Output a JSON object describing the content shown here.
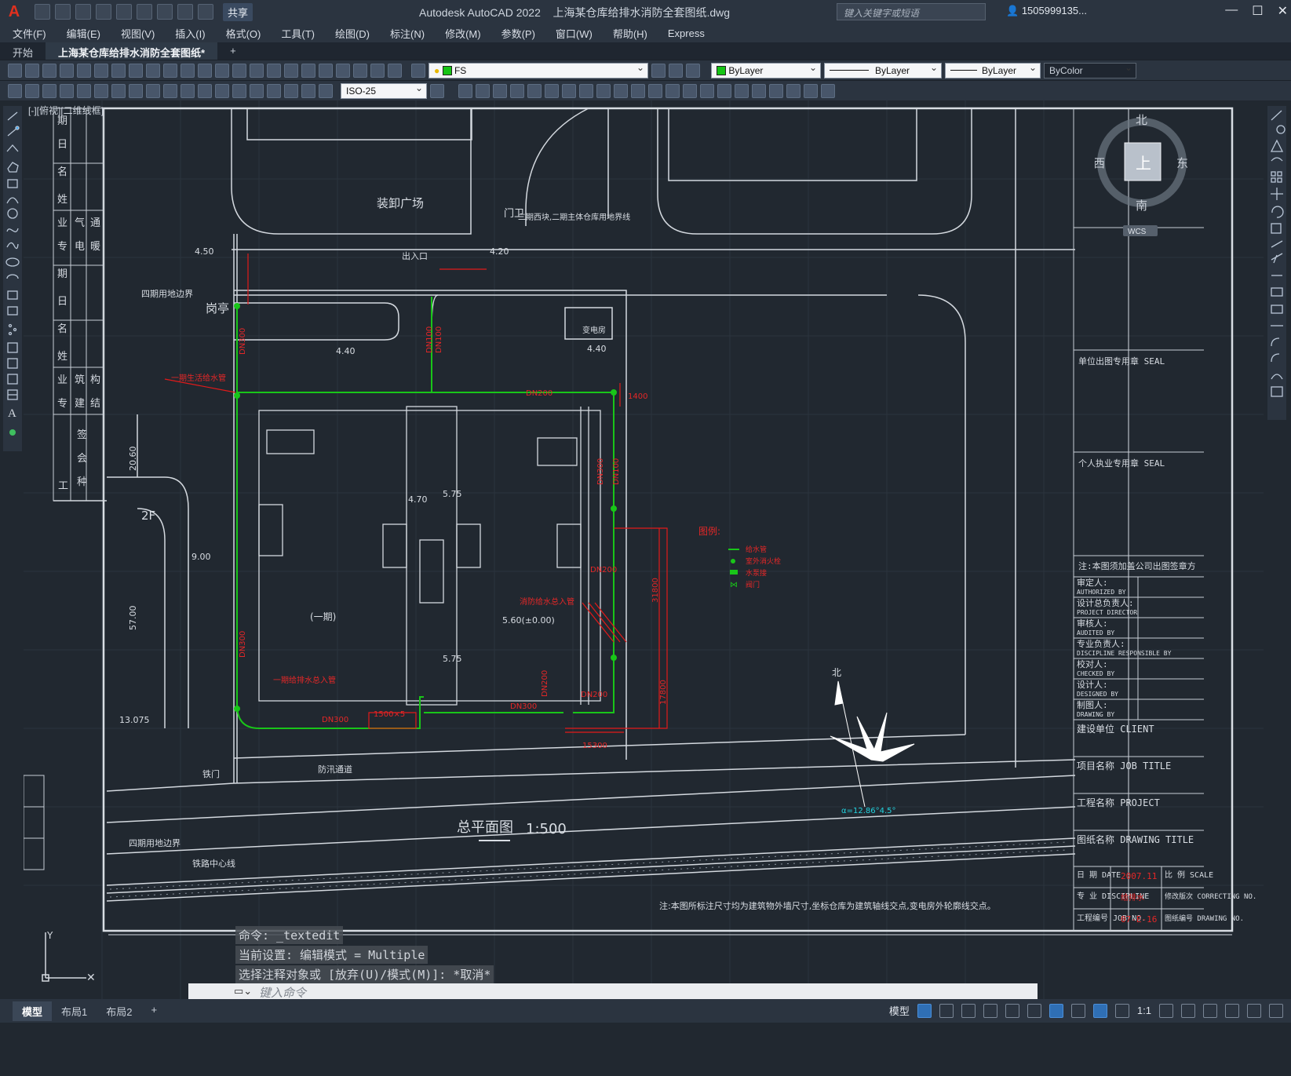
{
  "app": {
    "logo": "A",
    "title": "Autodesk AutoCAD 2022",
    "document": "上海某仓库给排水消防全套图纸.dwg",
    "share_label": "共享",
    "search_placeholder": "键入关键字或短语",
    "user": "1505999135...",
    "window_buttons": [
      "—",
      "☐",
      "✕"
    ]
  },
  "menu": [
    "文件(F)",
    "编辑(E)",
    "视图(V)",
    "插入(I)",
    "格式(O)",
    "工具(T)",
    "绘图(D)",
    "标注(N)",
    "修改(M)",
    "参数(P)",
    "窗口(W)",
    "帮助(H)",
    "Express"
  ],
  "file_tabs": [
    {
      "label": "开始",
      "active": false
    },
    {
      "label": "上海某仓库给排水消防全套图纸*",
      "active": true
    },
    {
      "label": "+",
      "active": false
    }
  ],
  "toolbar": {
    "layer_name": "FS",
    "color": "ByLayer",
    "linetype": "ByLayer",
    "lineweight": "ByLayer",
    "plotstyle": "ByColor",
    "dimstyle": "ISO-25"
  },
  "viewport_label": "[-][俯视][二维线框]",
  "viewcube": {
    "top": "北",
    "bottom": "南",
    "left": "西",
    "right": "东",
    "face": "上",
    "wcs": "WCS"
  },
  "drawing": {
    "plaza": "装卸广场",
    "gate": "门卫",
    "entrance": "出入口",
    "guard": "岗亭",
    "substation": "变电房",
    "boundary1": "四期用地边界",
    "boundary2": "四期用地边界",
    "boundary_note": "二期西块,二期主体仓库用地界线",
    "phase": "(一期)",
    "elev_main": "5.60(±0.00)",
    "road_gate": "铁门",
    "flood_channel": "防汛通道",
    "rail_center": "铁路中心线",
    "title": "总平面图",
    "scale": "1:500",
    "legend_title": "图例:",
    "north": "北",
    "note": "注:本图所标注尺寸均为建筑物外墙尺寸,坐标仓库为建筑轴线交点,变电房外轮廓线交点。",
    "dims": [
      "4.50",
      "4.20",
      "4.40",
      "4.40",
      "4.70",
      "5.75",
      "5.75",
      "20.60",
      "9.00",
      "57.00",
      "13.075",
      "15300",
      "17800",
      "31800",
      "2F",
      "DN300",
      "DN100",
      "DN200"
    ]
  },
  "titleblock": {
    "seal_unit": "单位出图专用章 SEAL",
    "seal_person": "个人执业专用章 SEAL",
    "seal_note": "注:本图须加盖公司出图签章方",
    "rows": [
      {
        "cn": "审定人:",
        "en": "AUTHORIZED BY"
      },
      {
        "cn": "设计总负责人:",
        "en": "PROJECT DIRECTOR"
      },
      {
        "cn": "审核人:",
        "en": "AUDITED BY"
      },
      {
        "cn": "专业负责人:",
        "en": "DISCIPLINE RESPONSIBLE BY"
      },
      {
        "cn": "校对人:",
        "en": "CHECKED BY"
      },
      {
        "cn": "设计人:",
        "en": "DESIGNED BY"
      },
      {
        "cn": "制图人:",
        "en": "DRAWING BY"
      }
    ],
    "client": "建设单位 CLIENT",
    "job": "项目名称 JOB TITLE",
    "project": "工程名称 PROJECT",
    "drawing_title": "图纸名称 DRAWING TITLE",
    "date_label": "日 期 DATE",
    "date_value": "2007.11",
    "scale_label": "比 例 SCALE",
    "discipline_label": "专 业 DISCIPLINE",
    "discipline_value": "给排水",
    "rev_label": "修改版次 CORRECTING NO.",
    "job_no_label": "工程编号 JOB NO.",
    "job_no_value": "07-E-16",
    "drawing_no_label": "图纸编号 DRAWING NO."
  },
  "command": {
    "history": [
      "命令: _textedit",
      "当前设置: 编辑模式 = Multiple",
      "选择注释对象或 [放弃(U)/模式(M)]: *取消*"
    ],
    "placeholder": "键入命令"
  },
  "layout_tabs": [
    {
      "label": "模型",
      "active": true
    },
    {
      "label": "布局1",
      "active": false
    },
    {
      "label": "布局2",
      "active": false
    },
    {
      "label": "+",
      "active": false
    }
  ],
  "status": {
    "model": "模型",
    "scale": "1:1"
  }
}
